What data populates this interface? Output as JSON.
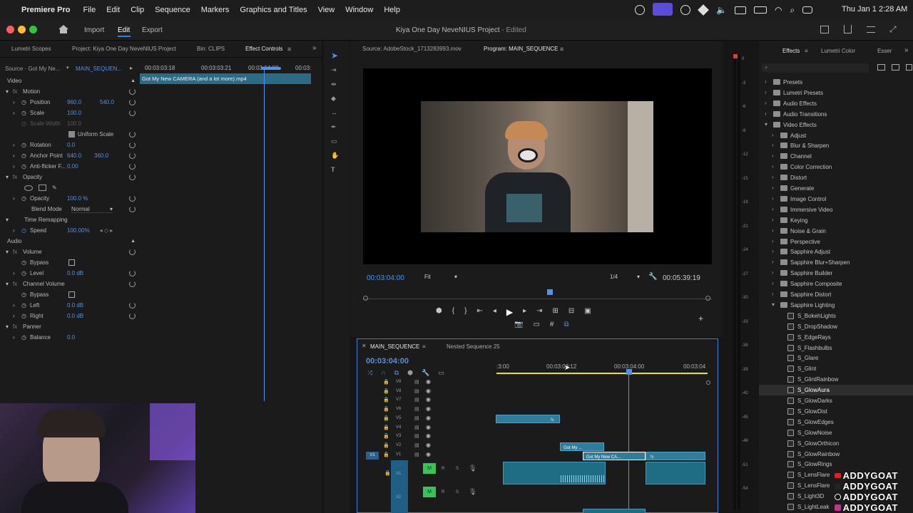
{
  "menubar": {
    "app": "Premiere Pro",
    "items": [
      "File",
      "Edit",
      "Clip",
      "Sequence",
      "Markers",
      "Graphics and Titles",
      "View",
      "Window",
      "Help"
    ],
    "clock": "Thu Jan 1  2:28 AM"
  },
  "header": {
    "nav": [
      "Import",
      "Edit",
      "Export"
    ],
    "active_nav": "Edit",
    "title": "Kiya One Day NeveNIUS Project",
    "edited": "- Edited"
  },
  "left_tabs": [
    "Lumetri Scopes",
    "Project: Kiya One Day NeveNIUS Project",
    "Bin: CLIPS",
    "Effect Controls"
  ],
  "effect_controls": {
    "source_label": "Source · Got My Ne...",
    "sequence_label": "MAIN_SEQUEN...",
    "ruler_times": [
      "00:03:03:18",
      "00:03:03:21",
      "00:03:04:00",
      "00:03:"
    ],
    "clip_name": "Got My New CAMERA (and a lot more).mp4",
    "sections": {
      "video": "Video",
      "audio": "Audio"
    },
    "rows": {
      "motion": "Motion",
      "position": "Position",
      "position_x": "960.0",
      "position_y": "540.0",
      "scale": "Scale",
      "scale_val": "100.0",
      "scale_width": "Scale Width",
      "scale_width_val": "100.0",
      "uniform_scale": "Uniform Scale",
      "rotation": "Rotation",
      "rotation_val": "0.0",
      "anchor": "Anchor Point",
      "anchor_x": "640.0",
      "anchor_y": "360.0",
      "antiflicker": "Anti-flicker F...",
      "antiflicker_val": "0.00",
      "opacity_hdr": "Opacity",
      "opacity": "Opacity",
      "opacity_val": "100.0 %",
      "blend": "Blend Mode",
      "blend_val": "Normal",
      "time_remap": "Time Remapping",
      "speed": "Speed",
      "speed_val": "100.00%",
      "volume": "Volume",
      "bypass": "Bypass",
      "level": "Level",
      "level_val": "0.0 dB",
      "channel_volume": "Channel Volume",
      "bypass2": "Bypass",
      "left": "Left",
      "left_val": "0.0 dB",
      "right": "Right",
      "right_val": "0.0 dB",
      "panner": "Panner",
      "balance": "Balance",
      "balance_val": "0.0"
    }
  },
  "monitor": {
    "source_tab": "Source: AdobeStock_1713283993.mov",
    "program_tab": "Program: MAIN_SEQUENCE",
    "timecode": "00:03:04:00",
    "fit": "Fit",
    "resolution": "1/4",
    "duration": "00:05:39:19"
  },
  "timeline": {
    "tab_main": "MAIN_SEQUENCE",
    "tab_nested": "Nested Sequence 25",
    "timecode": "00:03:04:00",
    "ruler": [
      ":3:00",
      "00:03:03:12",
      "00:03:04:00",
      "00:03:04"
    ],
    "video_tracks": [
      "V9",
      "V8",
      "V7",
      "V6",
      "V5",
      "V4",
      "V3",
      "V2",
      "V1"
    ],
    "audio_tracks": [
      "A1",
      "A2"
    ],
    "source_patch": "V1",
    "clip_v2": "Got My ...",
    "clip_v1": "Got My New CA...",
    "fx": "fx",
    "m": "M",
    "r": "R",
    "s": "S"
  },
  "meter_scale": [
    "0",
    "-3",
    "-6",
    "-9",
    "-12",
    "-15",
    "-18",
    "-21",
    "-24",
    "-27",
    "-30",
    "-33",
    "-36",
    "-39",
    "-42",
    "-45",
    "-48",
    "-51",
    "-54"
  ],
  "effects_panel": {
    "tabs": [
      "Effects",
      "Lumetri Color",
      "Esser"
    ],
    "top_folders": [
      "Presets",
      "Lumetri Presets",
      "Audio Effects",
      "Audio Transitions",
      "Video Effects"
    ],
    "video_folders": [
      "Adjust",
      "Blur & Sharpen",
      "Channel",
      "Color Correction",
      "Distort",
      "Generate",
      "Image Control",
      "Immersive Video",
      "Keying",
      "Noise & Grain",
      "Perspective",
      "Sapphire Adjust",
      "Sapphire Blur+Sharpen",
      "Sapphire Builder",
      "Sapphire Composite",
      "Sapphire Distort",
      "Sapphire Lighting"
    ],
    "lighting_items": [
      "S_BokehLights",
      "S_DropShadow",
      "S_EdgeRays",
      "S_Flashbulbs",
      "S_Glare",
      "S_Glint",
      "S_GlintRainbow",
      "S_GlowAura",
      "S_GlowDarks",
      "S_GlowDist",
      "S_GlowEdges",
      "S_GlowNoise",
      "S_GlowOrthicon",
      "S_GlowRainbow",
      "S_GlowRings",
      "S_LensFlare",
      "S_LensFlare",
      "S_Light3D",
      "S_LightLeak"
    ],
    "selected": "S_GlowAura"
  },
  "watermark": "ADDYGOAT",
  "colors": {
    "accent": "#3a7fd4",
    "timecode": "#4e93e6",
    "clip": "#2f7d9c",
    "playhead": "#4e93e6",
    "rail": "#e8e02a"
  }
}
